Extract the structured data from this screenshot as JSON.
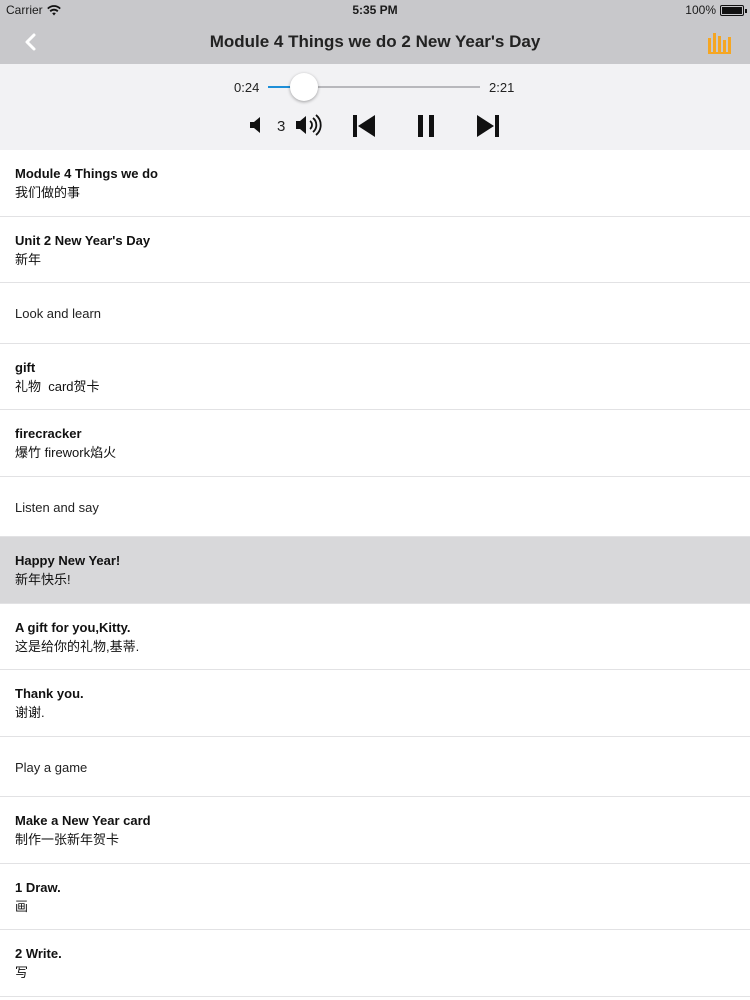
{
  "status_bar": {
    "carrier": "Carrier",
    "time": "5:35 PM",
    "battery": "100%"
  },
  "nav": {
    "title": "Module 4 Things we do 2 New Year's Day",
    "accent": "#f5a623"
  },
  "player": {
    "current_time": "0:24",
    "total_time": "2:21",
    "progress": 0.17,
    "volume": "3",
    "track_fill_color": "#1e8fd8"
  },
  "items": [
    {
      "en": "Module 4 Things we do",
      "zh": "我们做的事"
    },
    {
      "en": "Unit 2 New Year's Day",
      "zh": "新年"
    },
    {
      "en": "Look and learn"
    },
    {
      "en": "gift",
      "zh": "礼物  card贺卡"
    },
    {
      "en": "firecracker",
      "zh": "爆竹 firework焰火"
    },
    {
      "en": "Listen and say"
    },
    {
      "en": "Happy New Year!",
      "zh": "新年快乐!",
      "active": true
    },
    {
      "en": "A gift for you,Kitty.",
      "zh": "这是给你的礼物,基蒂."
    },
    {
      "en": "Thank you.",
      "zh": "谢谢."
    },
    {
      "en": "Play a game"
    },
    {
      "en": "Make a New Year card",
      "zh": "制作一张新年贺卡"
    },
    {
      "en": "1 Draw.",
      "zh": "画"
    },
    {
      "en": "2 Write.",
      "zh": "写"
    }
  ]
}
